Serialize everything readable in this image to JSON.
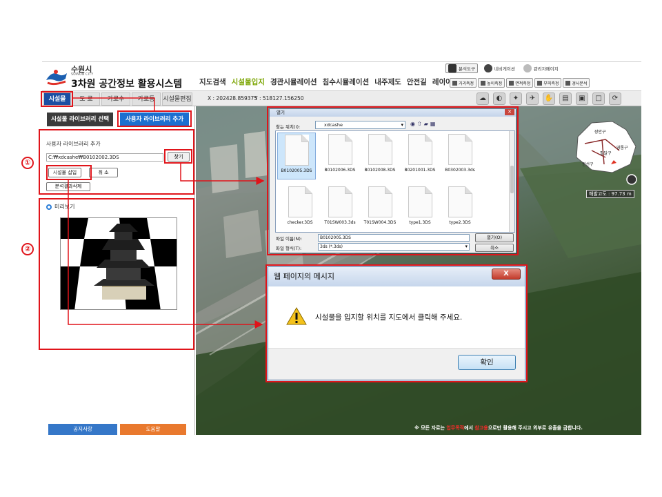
{
  "header": {
    "city_kr": "수원시",
    "city_en": "SUWON CITY",
    "system_title": "3차원 공간정보 활용시스템",
    "nav": [
      "지도검색",
      "시설물입지",
      "경관시뮬레이션",
      "침수시뮬레이션",
      "내주제도",
      "안전길",
      "레이어"
    ],
    "nav_active_index": 1,
    "tool_tabs": [
      "분석도구",
      "네비게이션",
      "관리자페이지"
    ],
    "measure_tools": [
      "거리측정",
      "높이측정",
      "면적측정",
      "부피측정",
      "경사분석"
    ]
  },
  "subtabs": {
    "facility": "시설물",
    "road": "도 로",
    "street": "가로수",
    "streetlight": "가로등",
    "edit": "시설물편집"
  },
  "coords": {
    "x_label": "X : 202428.859375",
    "y_label": "Y : 518127.156250"
  },
  "left_panel": {
    "lib_select": "시설물 라이브러리 선택",
    "lib_add": "사용자 라이브러리 추가",
    "add_title": "사용자 라이브러리 추가",
    "path_value": "C:₩xdcashe₩B0102002.3DS",
    "find_button": "찾기",
    "insert_button": "시설물 삽입",
    "cancel_button": "취 소",
    "delete_button": "분석결과삭제",
    "preview_title": "미리보기",
    "notice_button": "공지사항",
    "help_button": "도움말"
  },
  "map": {
    "altitude": "해발고도 : 97.73 m",
    "overview_districts": [
      "장안구",
      "영통구",
      "팔달구",
      "권선구"
    ],
    "disclaimer_prefix": "※ 모든 자료는 ",
    "disclaimer_red1": "업무목적",
    "disclaimer_mid": "에서 ",
    "disclaimer_red2": "참고용",
    "disclaimer_suffix": "으로만 활용해 주시고 외부로 유출을 금합니다."
  },
  "open_dialog": {
    "title": "열기",
    "lookin_label": "찾는 위치(I):",
    "lookin_value": "xdcashe",
    "files": [
      "B0102005.3DS",
      "B0102006.3DS",
      "B0102008.3DS",
      "B0201001.3DS",
      "B0302003.3ds",
      "checker.3DS",
      "T01SW003.3ds",
      "T01SW004.3DS",
      "type1.3DS",
      "type2.3DS"
    ],
    "selected_file_index": 0,
    "filename_label": "파일 이름(N):",
    "filename_value": "B0102005.3DS",
    "filetype_label": "파일 형식(T):",
    "filetype_value": "3ds (*.3ds)",
    "open_button": "열기(O)",
    "cancel_button": "취소"
  },
  "message_box": {
    "title": "웹 페이지의 메시지",
    "close": "X",
    "message": "시설물을 입지할 위치를 지도에서 클릭해 주세요.",
    "ok_button": "확인"
  },
  "annotations": {
    "marker_1": "①",
    "marker_2": "②"
  },
  "colors": {
    "annotation_red": "#e0141a",
    "active_tab_blue": "#1b4fa3",
    "nav_active_green": "#7aa400",
    "help_orange": "#e9792e",
    "notice_blue": "#3577c8"
  }
}
